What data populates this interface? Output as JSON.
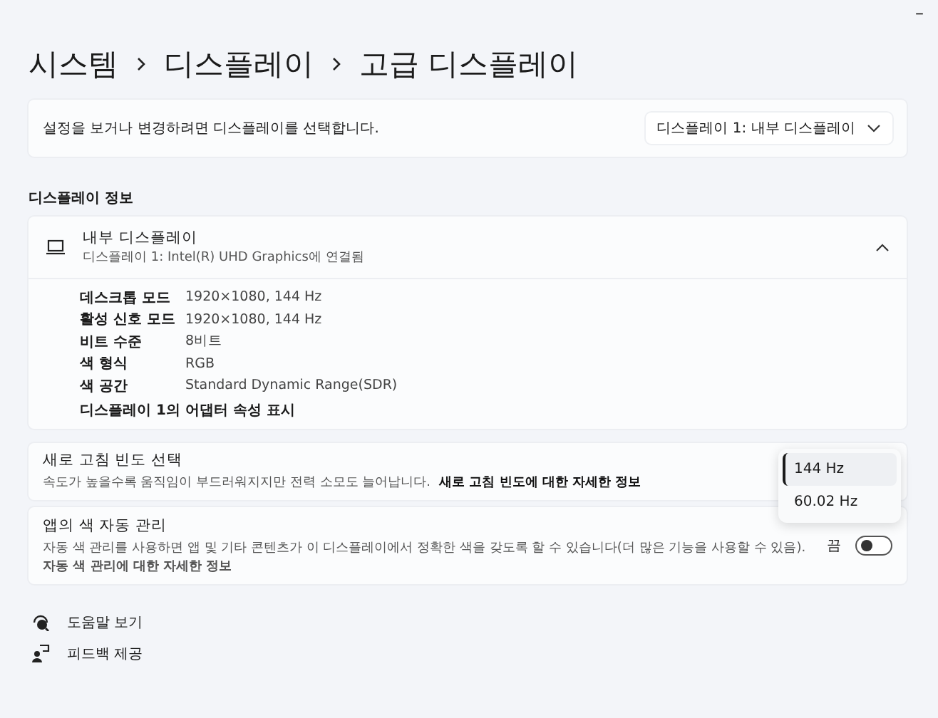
{
  "window": {
    "control": "–"
  },
  "breadcrumb": [
    "시스템",
    "디스플레이",
    "고급 디스플레이"
  ],
  "select_display": {
    "label": "설정을 보거나 변경하려면 디스플레이를 선택합니다.",
    "value": "디스플레이 1: 내부 디스플레이"
  },
  "section_title": "디스플레이 정보",
  "display_info": {
    "title": "내부 디스플레이",
    "subtitle": "디스플레이 1: Intel(R) UHD Graphics에 연결됨",
    "expanded": true,
    "rows": [
      {
        "label": "데스크톱 모드",
        "value": "1920×1080, 144 Hz"
      },
      {
        "label": "활성 신호 모드",
        "value": "1920×1080, 144 Hz"
      },
      {
        "label": "비트 수준",
        "value": "8비트"
      },
      {
        "label": "색 형식",
        "value": "RGB"
      },
      {
        "label": "색 공간",
        "value": "Standard Dynamic Range(SDR)"
      }
    ],
    "link": "디스플레이 1의 어댑터 속성 표시"
  },
  "refresh_rate": {
    "title": "새로 고침 빈도 선택",
    "description": "속도가 높을수록 움직임이 부드러워지지만 전력 소모도 늘어납니다.",
    "link": "새로 고침 빈도에 대한 자세한 정보",
    "options": [
      {
        "label": "144 Hz",
        "selected": true
      },
      {
        "label": "60.02 Hz",
        "selected": false
      }
    ]
  },
  "auto_color": {
    "title": "앱의 색 자동 관리",
    "description": "자동 색 관리를 사용하면 앱 및 기타 콘텐츠가 이 디스플레이에서 정확한 색을 갖도록 할 수 있습니다(더 많은 기능을 사용할 수 있음).",
    "link": "자동 색 관리에 대한 자세한 정보",
    "state_label": "끔",
    "on": false
  },
  "footer_links": [
    {
      "kind": "help",
      "label": "도움말 보기"
    },
    {
      "kind": "feedback",
      "label": "피드백 제공"
    }
  ]
}
